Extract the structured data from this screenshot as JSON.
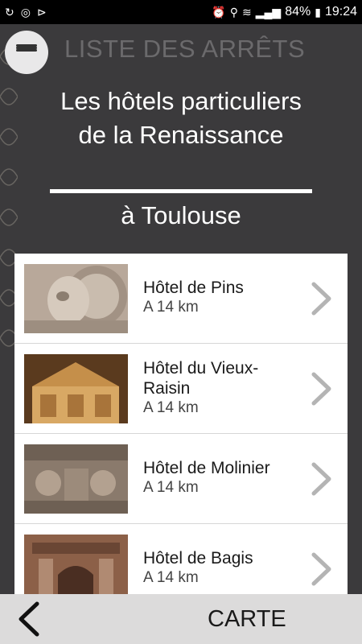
{
  "status_bar": {
    "battery": "84%",
    "time": "19:24",
    "left_icons": [
      "sync-icon",
      "data-saver-icon",
      "notification-icon"
    ],
    "right_icons": [
      "alarm-icon",
      "location-icon",
      "wifi-icon",
      "signal-icon",
      "battery-icon"
    ]
  },
  "header": {
    "title": "LISTE DES ARRÊTS",
    "menu_icon": "hamburger-menu-icon"
  },
  "tour": {
    "title": "Les hôtels particuliers de la Renaissance",
    "subtitle": "à Toulouse"
  },
  "stops": [
    {
      "name": "Hôtel de Pins",
      "distance": "A 14 km"
    },
    {
      "name": "Hôtel du Vieux-Raisin",
      "distance": "A 14 km"
    },
    {
      "name": "Hôtel de Molinier",
      "distance": "A 14 km"
    },
    {
      "name": "Hôtel de Bagis",
      "distance": "A 14 km"
    }
  ],
  "bottom_bar": {
    "back_icon": "chevron-left-icon",
    "map_label": "CARTE"
  },
  "colors": {
    "background": "#3b3a3c",
    "header_title": "#6b6a6c",
    "bottom_bar": "#dcdbdb",
    "chevron": "#b4b4b4"
  }
}
